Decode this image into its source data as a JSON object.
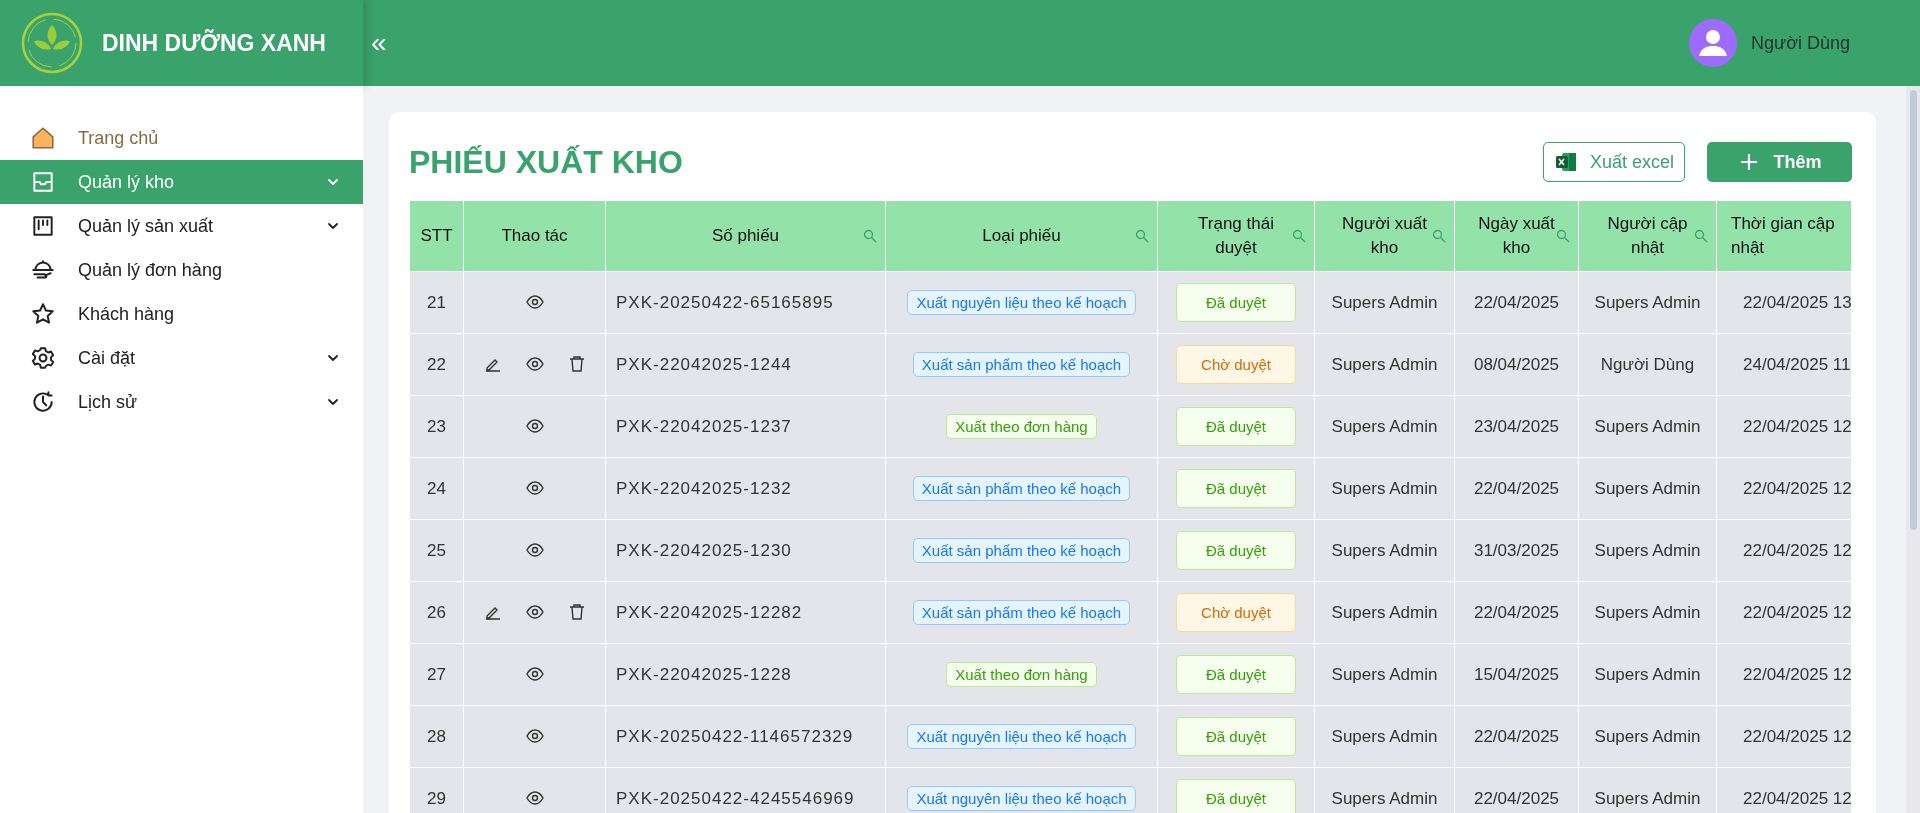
{
  "app": {
    "brand": "DINH DƯỠNG XANH",
    "collapse_icon": "«"
  },
  "user": {
    "name": "Người Dùng"
  },
  "sidebar": {
    "items": [
      {
        "label": "Trang chủ",
        "selected": false,
        "has_submenu": false
      },
      {
        "label": "Quản lý kho",
        "selected": true,
        "has_submenu": true
      },
      {
        "label": "Quản lý sản xuất",
        "selected": false,
        "has_submenu": true
      },
      {
        "label": "Quản lý đơn hàng",
        "selected": false,
        "has_submenu": false
      },
      {
        "label": "Khách hàng",
        "selected": false,
        "has_submenu": false
      },
      {
        "label": "Cài đặt",
        "selected": false,
        "has_submenu": true
      },
      {
        "label": "Lịch sử",
        "selected": false,
        "has_submenu": true
      }
    ]
  },
  "page": {
    "title": "PHIẾU XUẤT KHO",
    "buttons": [
      {
        "label": "Xuất excel",
        "kind": "excel"
      },
      {
        "label": "Thêm",
        "kind": "add"
      }
    ]
  },
  "table": {
    "columns": [
      {
        "label": "STT",
        "searchable": false
      },
      {
        "label": "Thao tác",
        "searchable": false
      },
      {
        "label": "Số phiếu",
        "searchable": true
      },
      {
        "label": "Loại phiếu",
        "searchable": true
      },
      {
        "label": "Trạng thái duyệt",
        "searchable": true
      },
      {
        "label": "Người xuất kho",
        "searchable": true
      },
      {
        "label": "Ngày xuất kho",
        "searchable": true
      },
      {
        "label": "Người cập nhật",
        "searchable": true
      },
      {
        "label": "Thời gian cập nhật",
        "searchable": false
      }
    ],
    "rows": [
      {
        "stt": "21",
        "editable": false,
        "code": "PXK-20250422-65165895",
        "type": {
          "label": "Xuất nguyên liệu theo kế hoạch",
          "kind": "plan"
        },
        "status": {
          "label": "Đã duyệt",
          "kind": "approved"
        },
        "issuer": "Supers Admin",
        "date": "22/04/2025",
        "updater": "Supers Admin",
        "updated": "22/04/2025 13"
      },
      {
        "stt": "22",
        "editable": true,
        "code": "PXK-22042025-1244",
        "type": {
          "label": "Xuất sản phẩm theo kế hoạch",
          "kind": "plan"
        },
        "status": {
          "label": "Chờ duyệt",
          "kind": "pending"
        },
        "issuer": "Supers Admin",
        "date": "08/04/2025",
        "updater": "Người Dùng",
        "updated": "24/04/2025 11"
      },
      {
        "stt": "23",
        "editable": false,
        "code": "PXK-22042025-1237",
        "type": {
          "label": "Xuất theo đơn hàng",
          "kind": "order"
        },
        "status": {
          "label": "Đã duyệt",
          "kind": "approved"
        },
        "issuer": "Supers Admin",
        "date": "23/04/2025",
        "updater": "Supers Admin",
        "updated": "22/04/2025 12"
      },
      {
        "stt": "24",
        "editable": false,
        "code": "PXK-22042025-1232",
        "type": {
          "label": "Xuất sản phẩm theo kế hoạch",
          "kind": "plan"
        },
        "status": {
          "label": "Đã duyệt",
          "kind": "approved"
        },
        "issuer": "Supers Admin",
        "date": "22/04/2025",
        "updater": "Supers Admin",
        "updated": "22/04/2025 12"
      },
      {
        "stt": "25",
        "editable": false,
        "code": "PXK-22042025-1230",
        "type": {
          "label": "Xuất sản phẩm theo kế hoạch",
          "kind": "plan"
        },
        "status": {
          "label": "Đã duyệt",
          "kind": "approved"
        },
        "issuer": "Supers Admin",
        "date": "31/03/2025",
        "updater": "Supers Admin",
        "updated": "22/04/2025 12"
      },
      {
        "stt": "26",
        "editable": true,
        "code": "PXK-22042025-12282",
        "type": {
          "label": "Xuất sản phẩm theo kế hoạch",
          "kind": "plan"
        },
        "status": {
          "label": "Chờ duyệt",
          "kind": "pending"
        },
        "issuer": "Supers Admin",
        "date": "22/04/2025",
        "updater": "Supers Admin",
        "updated": "22/04/2025 12"
      },
      {
        "stt": "27",
        "editable": false,
        "code": "PXK-22042025-1228",
        "type": {
          "label": "Xuất theo đơn hàng",
          "kind": "order"
        },
        "status": {
          "label": "Đã duyệt",
          "kind": "approved"
        },
        "issuer": "Supers Admin",
        "date": "15/04/2025",
        "updater": "Supers Admin",
        "updated": "22/04/2025 12"
      },
      {
        "stt": "28",
        "editable": false,
        "code": "PXK-20250422-1146572329",
        "type": {
          "label": "Xuất nguyên liệu theo kế hoạch",
          "kind": "plan"
        },
        "status": {
          "label": "Đã duyệt",
          "kind": "approved"
        },
        "issuer": "Supers Admin",
        "date": "22/04/2025",
        "updater": "Supers Admin",
        "updated": "22/04/2025 12"
      },
      {
        "stt": "29",
        "editable": false,
        "code": "PXK-20250422-4245546969",
        "type": {
          "label": "Xuất nguyên liệu theo kế hoạch",
          "kind": "plan"
        },
        "status": {
          "label": "Đã duyệt",
          "kind": "approved"
        },
        "issuer": "Supers Admin",
        "date": "22/04/2025",
        "updater": "Supers Admin",
        "updated": "22/04/2025 12"
      }
    ]
  }
}
